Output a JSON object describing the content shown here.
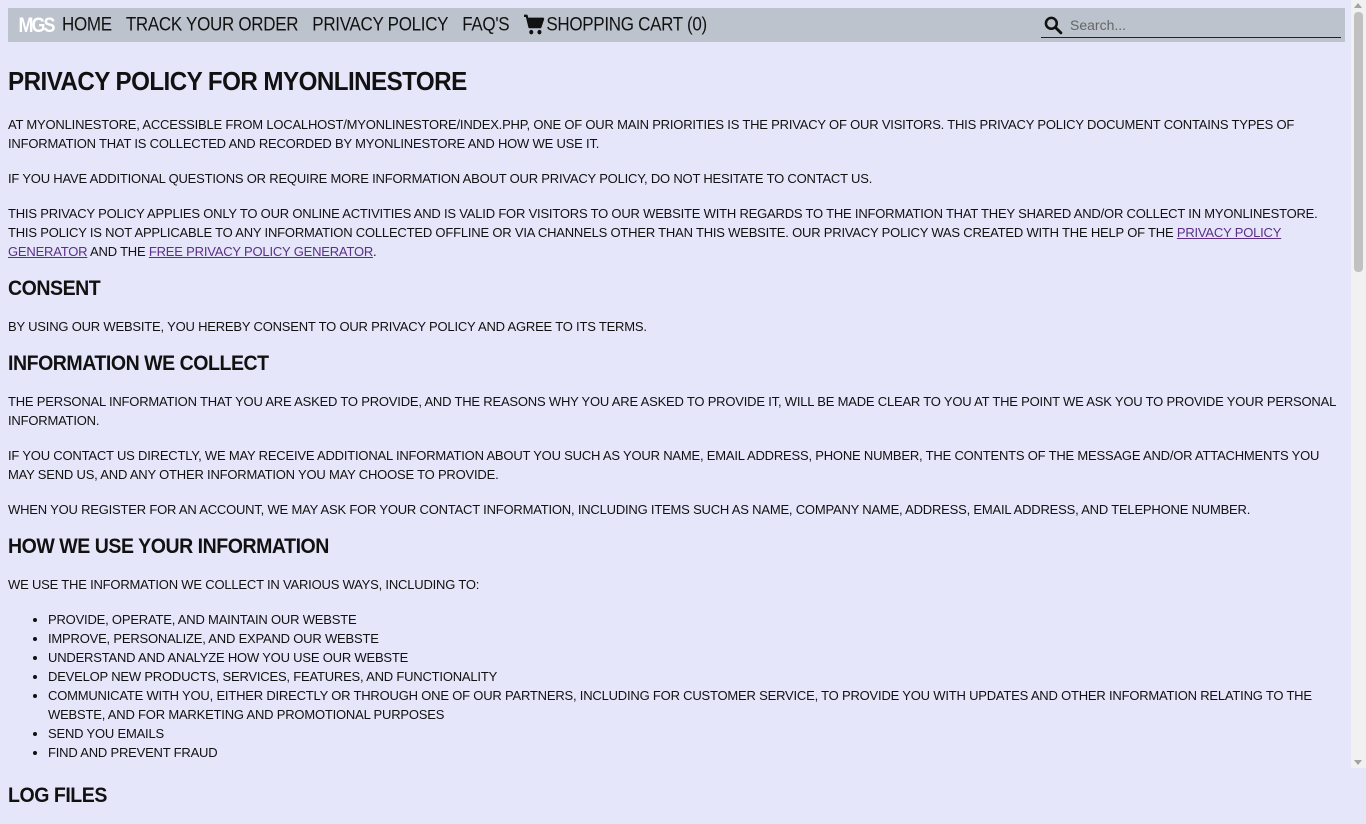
{
  "nav": {
    "logo": "MGS",
    "links": [
      "HOME",
      "TRACK YOUR ORDER",
      "PRIVACY POLICY",
      "FAQ'S"
    ],
    "cart_label": "SHOPPING CART (0)",
    "search_placeholder": "Search..."
  },
  "page": {
    "title": "Privacy Policy for MyOnlineStore",
    "intro_p1": "At MyOnlineStore, accessible from localhost/myonlinestore/index.php, one of our main priorities is the privacy of our visitors. This Privacy Policy document contains types of information that is collected and recorded by MyOnlineStore and how we use it.",
    "intro_p2": "If you have additional questions or require more information about our Privacy Policy, do not hesitate to contact us.",
    "intro_p3_a": "This Privacy Policy applies only to our online activities and is valid for visitors to our website with regards to the information that they shared and/or collect in MyOnlineStore. This policy is not applicable to any information collected offline or via channels other than this website. Our Privacy Policy was created with the help of the ",
    "intro_p3_link1": "Privacy Policy Generator",
    "intro_p3_b": " and the ",
    "intro_p3_link2": "Free Privacy Policy Generator",
    "intro_p3_c": ".",
    "consent_heading": "Consent",
    "consent_p": "By using our website, you hereby consent to our Privacy Policy and agree to its terms.",
    "collect_heading": "Information we collect",
    "collect_p1": "The personal information that you are asked to provide, and the reasons why you are asked to provide it, will be made clear to you at the point we ask you to provide your personal information.",
    "collect_p2": "If you contact us directly, we may receive additional information about you such as your name, email address, phone number, the contents of the message and/or attachments you may send us, and any other information you may choose to provide.",
    "collect_p3": "When you register for an Account, we may ask for your contact information, including items such as name, company name, address, email address, and telephone number.",
    "use_heading": "How we use your information",
    "use_p": "We use the information we collect in various ways, including to:",
    "use_items": [
      "Provide, operate, and maintain our webste",
      "Improve, personalize, and expand our webste",
      "Understand and analyze how you use our webste",
      "Develop new products, services, features, and functionality",
      "Communicate with you, either directly or through one of our partners, including for customer service, to provide you with updates and other information relating to the webste, and for marketing and promotional purposes",
      "Send you emails",
      "Find and prevent fraud"
    ],
    "log_heading": "Log Files"
  }
}
